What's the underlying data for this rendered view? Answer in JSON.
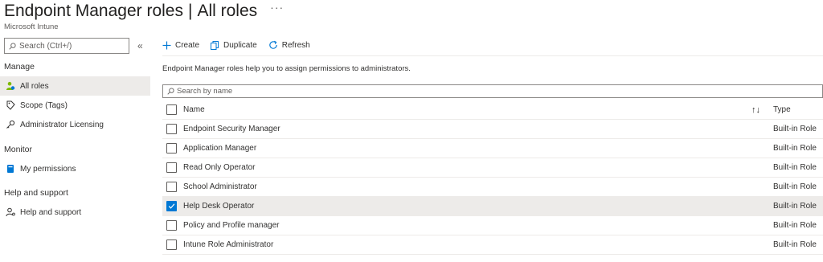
{
  "header": {
    "title": "Endpoint Manager roles",
    "separator": "|",
    "subtitle_page": "All roles",
    "more": "···",
    "service": "Microsoft Intune"
  },
  "sidebar": {
    "search_placeholder": "Search (Ctrl+/)",
    "collapse": "«",
    "sections": [
      {
        "label": "Manage",
        "items": [
          {
            "label": "All roles",
            "icon": "user-roles-icon",
            "active": true
          },
          {
            "label": "Scope (Tags)",
            "icon": "tag-icon",
            "active": false
          },
          {
            "label": "Administrator Licensing",
            "icon": "key-icon",
            "active": false
          }
        ]
      },
      {
        "label": "Monitor",
        "items": [
          {
            "label": "My permissions",
            "icon": "book-icon",
            "active": false
          }
        ]
      },
      {
        "label": "Help and support",
        "items": [
          {
            "label": "Help and support",
            "icon": "person-help-icon",
            "active": false
          }
        ]
      }
    ]
  },
  "toolbar": {
    "create": "Create",
    "duplicate": "Duplicate",
    "refresh": "Refresh"
  },
  "main": {
    "description": "Endpoint Manager roles help you to assign permissions to administrators.",
    "filter_placeholder": "Search by name"
  },
  "table": {
    "columns": {
      "name": "Name",
      "sort": "↑↓",
      "type": "Type"
    },
    "rows": [
      {
        "name": "Endpoint Security Manager",
        "type": "Built-in Role",
        "checked": false
      },
      {
        "name": "Application Manager",
        "type": "Built-in Role",
        "checked": false
      },
      {
        "name": "Read Only Operator",
        "type": "Built-in Role",
        "checked": false
      },
      {
        "name": "School Administrator",
        "type": "Built-in Role",
        "checked": false
      },
      {
        "name": "Help Desk Operator",
        "type": "Built-in Role",
        "checked": true
      },
      {
        "name": "Policy and Profile manager",
        "type": "Built-in Role",
        "checked": false
      },
      {
        "name": "Intune Role Administrator",
        "type": "Built-in Role",
        "checked": false
      }
    ]
  },
  "colors": {
    "accent": "#0078d4",
    "selected_bg": "#edebe9",
    "text": "#323130"
  }
}
